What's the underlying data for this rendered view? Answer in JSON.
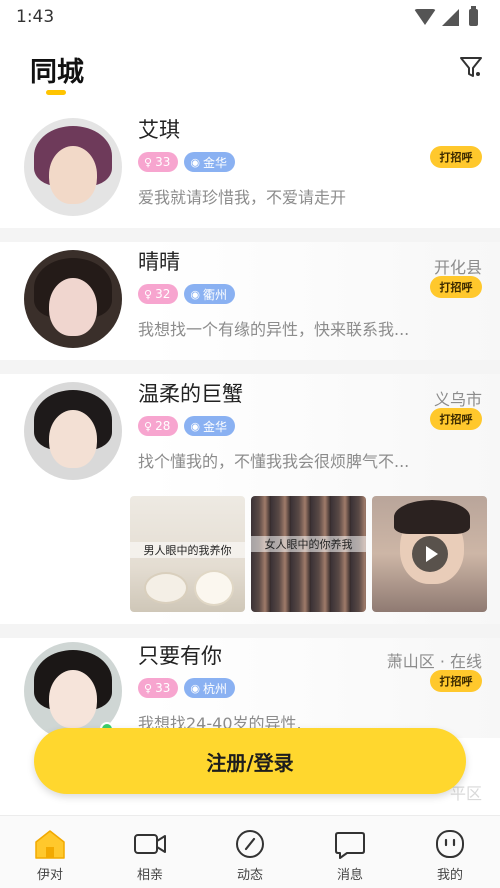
{
  "status_bar": {
    "time": "1:43"
  },
  "header": {
    "title": "同城"
  },
  "users": [
    {
      "name": "艾琪",
      "age": "33",
      "city": "金华",
      "bio": "爱我就请珍惜我，不爱请走开",
      "distance": "",
      "greet": "打招呼"
    },
    {
      "name": "晴晴",
      "age": "32",
      "city": "衢州",
      "bio": "我想找一个有缘的异性，快来联系我...",
      "distance": "开化县",
      "greet": "打招呼"
    },
    {
      "name": "温柔的巨蟹",
      "age": "28",
      "city": "金华",
      "bio": "找个懂我的，不懂我我会很烦脾气不...",
      "distance": "义乌市",
      "greet": "打招呼"
    },
    {
      "name": "只要有你",
      "age": "33",
      "city": "杭州",
      "bio": "我想找24-40岁的异性.",
      "distance": "萧山区 · 在线",
      "greet": "打招呼"
    }
  ],
  "photos": [
    {
      "caption": "男人眼中的我养你"
    },
    {
      "caption": "女人眼中的你养我"
    }
  ],
  "ghost_text": {
    "distance": "平区"
  },
  "register_button": "注册/登录",
  "tabs": [
    {
      "label": "伊对",
      "icon": "home-icon",
      "active": true
    },
    {
      "label": "相亲",
      "icon": "video-camera-icon"
    },
    {
      "label": "动态",
      "icon": "compass-icon"
    },
    {
      "label": "消息",
      "icon": "chat-bubble-icon"
    },
    {
      "label": "我的",
      "icon": "profile-face-icon"
    }
  ],
  "colors": {
    "accent": "#FFC82C",
    "register": "#FFD72E",
    "age_tag": "#f7a5cf",
    "loc_tag": "#8ab1f2",
    "online": "#3ccf6a"
  }
}
